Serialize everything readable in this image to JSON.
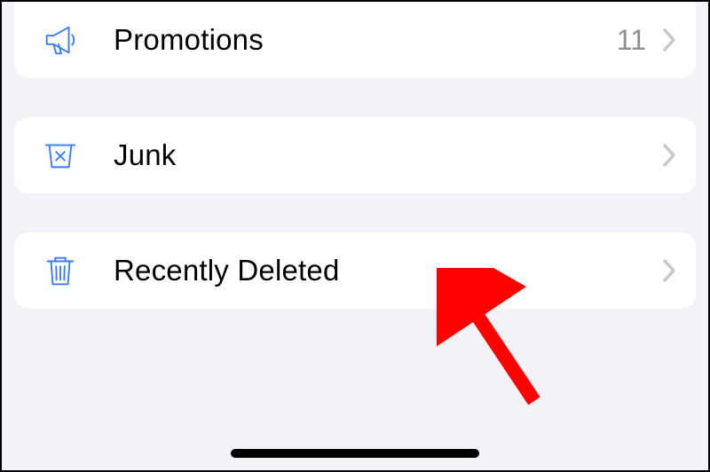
{
  "mailboxes": {
    "promotions": {
      "label": "Promotions",
      "count": "11"
    },
    "junk": {
      "label": "Junk"
    },
    "recently_deleted": {
      "label": "Recently Deleted"
    }
  },
  "colors": {
    "accent": "#3b7bff",
    "annotation": "#ff0000"
  }
}
